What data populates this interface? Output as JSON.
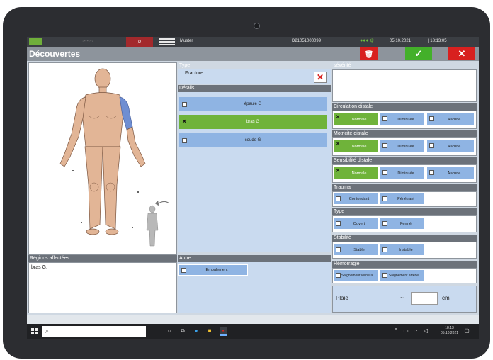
{
  "topbar": {
    "muster": "Muster",
    "patient_id": "D21051000099",
    "date": "05.10.2021",
    "time": "| 18:13:05",
    "signal": "●●● ψ",
    "dots": "·-|-·-·"
  },
  "title": "Découvertes",
  "actions": {
    "delete": "🗑",
    "confirm": "✓",
    "cancel": "✕"
  },
  "regions": {
    "header": "Régions affectées",
    "value": "bras G,"
  },
  "type": {
    "header": "Type",
    "value": "Fracture",
    "clear": "✕"
  },
  "details": {
    "header": "Détails",
    "items": [
      {
        "label": "épaule G",
        "checked": false
      },
      {
        "label": "bras G",
        "checked": true
      },
      {
        "label": "coude G",
        "checked": false
      }
    ]
  },
  "autre": {
    "header": "Autre",
    "option": "Empalement"
  },
  "severity": {
    "header": "sévérité"
  },
  "circulation": {
    "header": "Circulation distale",
    "options": [
      "Normale",
      "Diminuée",
      "Aucune"
    ]
  },
  "motricite": {
    "header": "Motricité distale",
    "options": [
      "Normale",
      "Diminuée",
      "Aucune"
    ]
  },
  "sensibilite": {
    "header": "Sensibilité distale",
    "options": [
      "Normale",
      "Diminuée",
      "Aucune"
    ]
  },
  "trauma": {
    "header": "Trauma",
    "options": [
      "Contondant",
      "Pénétrant"
    ]
  },
  "type2": {
    "header": "Type",
    "options": [
      "Ouvert",
      "Fermé"
    ]
  },
  "stabilite": {
    "header": "Stabilité",
    "options": [
      "Stable",
      "Instable"
    ]
  },
  "hemorragie": {
    "header": "Hémorragie",
    "options": [
      "Saignement veineux",
      "Saignement artériel"
    ]
  },
  "plaie": {
    "label": "Plaie",
    "tilde": "~",
    "value": "",
    "unit": "cm"
  },
  "taskbar": {
    "search_icon": "⌕",
    "clock_time": "18:13",
    "clock_date": "05.10.2021"
  },
  "colors": {
    "selected": "#6fb33a",
    "option": "#8fb4e3",
    "danger": "#d8201f",
    "ok": "#43b02a"
  }
}
